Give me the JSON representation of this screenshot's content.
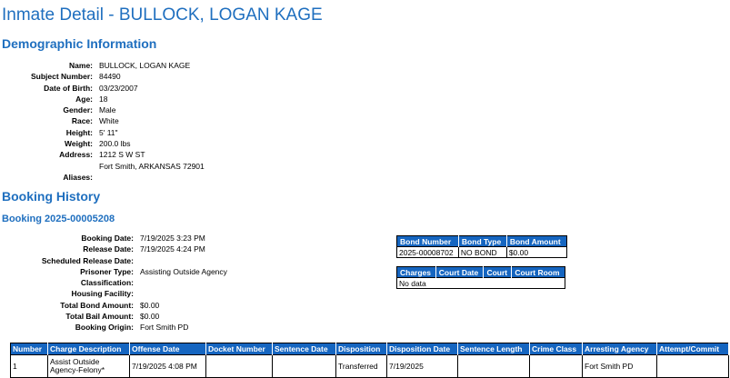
{
  "page_title": "Inmate Detail - BULLOCK, LOGAN KAGE",
  "demographics": {
    "heading": "Demographic Information",
    "name_label": "Name:",
    "name": "BULLOCK, LOGAN KAGE",
    "subject_label": "Subject Number:",
    "subject": "84490",
    "dob_label": "Date of Birth:",
    "dob": "03/23/2007",
    "age_label": "Age:",
    "age": "18",
    "gender_label": "Gender:",
    "gender": "Male",
    "race_label": "Race:",
    "race": "White",
    "height_label": "Height:",
    "height": "5' 11\"",
    "weight_label": "Weight:",
    "weight": "200.0 lbs",
    "address_label": "Address:",
    "address_line1": "1212 S W ST",
    "address_line2": "Fort Smith, ARKANSAS 72901",
    "aliases_label": "Aliases:",
    "aliases": ""
  },
  "booking_history": {
    "heading": "Booking History",
    "booking_title": "Booking 2025-00005208",
    "booking_date_label": "Booking Date:",
    "booking_date": "7/19/2025 3:23 PM",
    "release_date_label": "Release Date:",
    "release_date": "7/19/2025 4:24 PM",
    "sched_release_label": "Scheduled Release Date:",
    "sched_release": "",
    "prisoner_type_label": "Prisoner Type:",
    "prisoner_type": "Assisting Outside Agency",
    "classification_label": "Classification:",
    "classification": "",
    "housing_label": "Housing Facility:",
    "housing": "",
    "total_bond_label": "Total Bond Amount:",
    "total_bond": "$0.00",
    "total_bail_label": "Total Bail Amount:",
    "total_bail": "$0.00",
    "origin_label": "Booking Origin:",
    "origin": "Fort Smith PD"
  },
  "bond_table": {
    "headers": [
      "Bond Number",
      "Bond Type",
      "Bond Amount"
    ],
    "row": [
      "2025-00008702",
      "NO BOND",
      "$0.00"
    ]
  },
  "court_table": {
    "headers": [
      "Charges",
      "Court Date",
      "Court",
      "Court Room"
    ],
    "empty": "No data"
  },
  "charges_table": {
    "headers": [
      "Number",
      "Charge Description",
      "Offense Date",
      "Docket Number",
      "Sentence Date",
      "Disposition",
      "Disposition Date",
      "Sentence Length",
      "Crime Class",
      "Arresting Agency",
      "Attempt/Commit"
    ],
    "row": [
      "1",
      "Assist Outside Agency-Felony*",
      "7/19/2025 4:08 PM",
      "",
      "",
      "Transferred",
      "7/19/2025",
      "",
      "",
      "Fort Smith PD",
      ""
    ]
  }
}
